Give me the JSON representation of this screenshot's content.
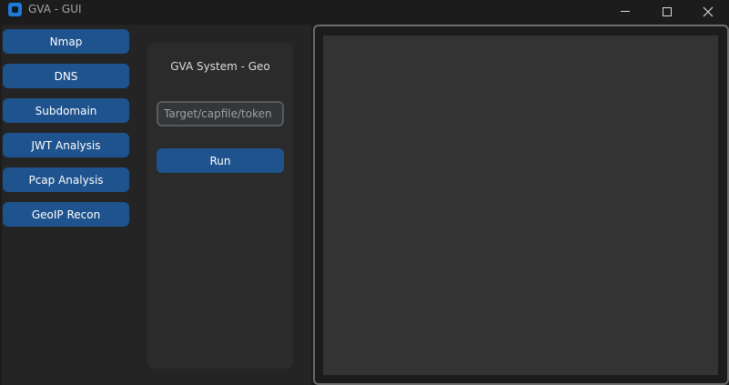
{
  "window": {
    "title": "GVA - GUI"
  },
  "sidebar": {
    "items": [
      {
        "label": "Nmap"
      },
      {
        "label": "DNS"
      },
      {
        "label": "Subdomain"
      },
      {
        "label": "JWT Analysis"
      },
      {
        "label": "Pcap Analysis"
      },
      {
        "label": "GeoIP Recon"
      }
    ]
  },
  "panel": {
    "title": "GVA System - Geo",
    "target_placeholder": "Target/capfile/token",
    "target_value": "",
    "run_label": "Run"
  },
  "output": {
    "text": ""
  },
  "colors": {
    "accent": "#1f538d",
    "app_icon": "#1f7ad6",
    "background": "#1c1c1c",
    "panel": "#242424",
    "card": "#2b2b2b",
    "output": "#333333"
  }
}
